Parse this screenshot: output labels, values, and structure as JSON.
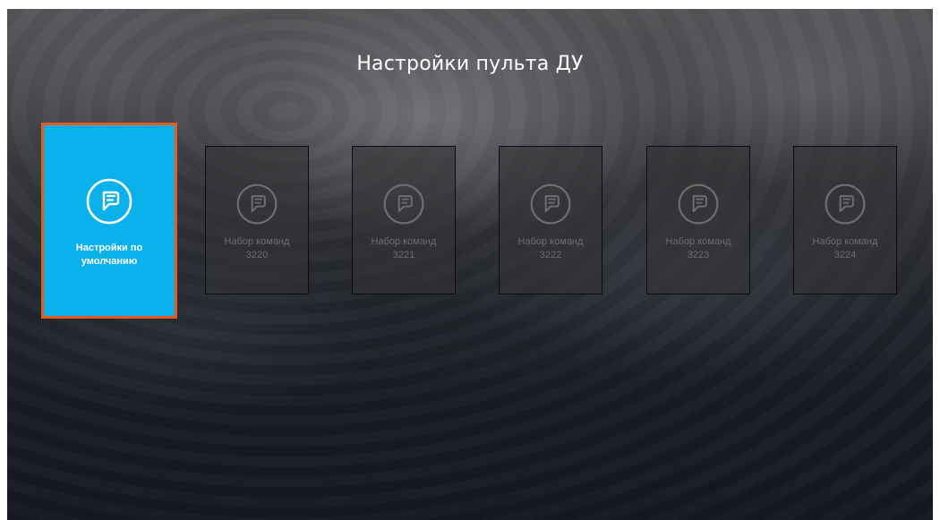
{
  "header": {
    "title": "Настройки пульта ДУ"
  },
  "colors": {
    "selected_fill": "#0ab1ea",
    "focus_border": "#ea5a1d",
    "card_text_inactive": "#6d6e72"
  },
  "cards": [
    {
      "label": "Настройки по\nумолчанию",
      "icon": "remote-icon",
      "selected": true
    },
    {
      "label": "Набор команд\n3220",
      "icon": "remote-icon",
      "selected": false
    },
    {
      "label": "Набор команд\n3221",
      "icon": "remote-icon",
      "selected": false
    },
    {
      "label": "Набор команд\n3222",
      "icon": "remote-icon",
      "selected": false
    },
    {
      "label": "Набор команд\n3223",
      "icon": "remote-icon",
      "selected": false
    },
    {
      "label": "Набор команд\n3224",
      "icon": "remote-icon",
      "selected": false
    }
  ]
}
